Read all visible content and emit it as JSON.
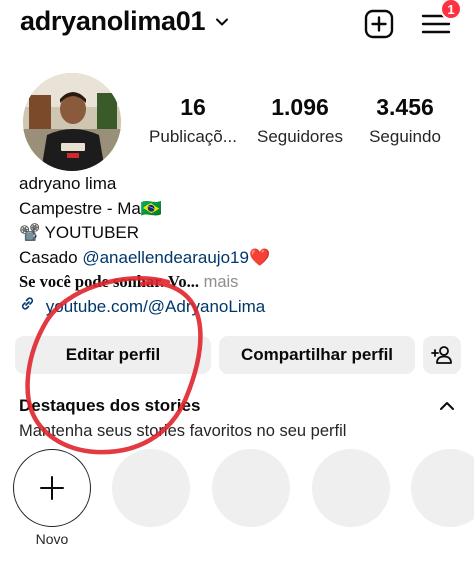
{
  "header": {
    "username": "adryanolima01",
    "notification_count": "1",
    "icons": [
      "chevron-down-icon",
      "new-post-icon",
      "menu-icon"
    ]
  },
  "profile": {
    "stats": {
      "posts": {
        "count": "16",
        "label": "Publicaçõ..."
      },
      "followers": {
        "count": "1.096",
        "label": "Seguidores"
      },
      "following": {
        "count": "3.456",
        "label": "Seguindo"
      }
    },
    "name": "adryano lima",
    "bio": {
      "line1": "Campestre - Ma🇧🇷",
      "line2": "📽️ YOUTUBER",
      "line3_prefix": "Casado ",
      "line3_mention": "@anaellendearaujo19",
      "line3_suffix": "❤️",
      "line4_text": "Se você pode sonhar. Vo...",
      "line4_more": " mais",
      "link": "youtube.com/@AdryanoLima"
    }
  },
  "actions": {
    "edit_profile": "Editar perfil",
    "share_profile": "Compartilhar perfil"
  },
  "highlights": {
    "title": "Destaques dos stories",
    "subtitle": "Mantenha seus stories favoritos no seu perfil",
    "new_label": "Novo"
  },
  "colors": {
    "link": "#00376b",
    "badge": "#ff3040",
    "button_bg": "#efefef",
    "annotation": "#e0242b"
  }
}
